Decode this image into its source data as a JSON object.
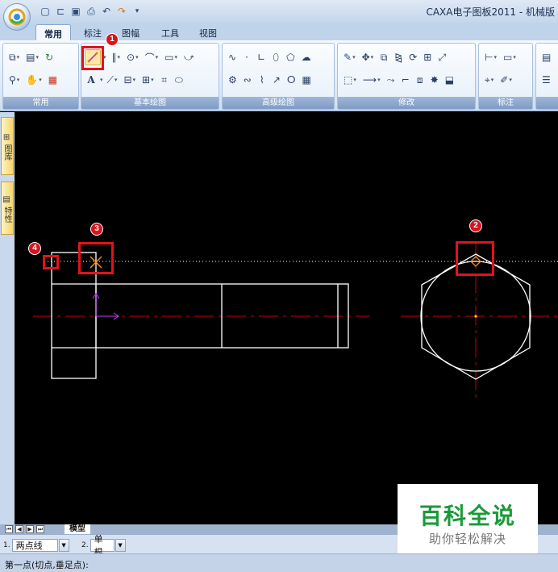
{
  "window": {
    "title": "CAXA电子图板2011 - 机械版"
  },
  "quick_access": [
    "new-icon",
    "open-icon",
    "save-icon",
    "print-icon",
    "undo-icon",
    "redo-icon",
    "customize-icon"
  ],
  "ribbon": {
    "tabs": [
      {
        "label": "常用",
        "active": true
      },
      {
        "label": "标注",
        "active": false
      },
      {
        "label": "图幅",
        "active": false
      },
      {
        "label": "工具",
        "active": false
      },
      {
        "label": "视图",
        "active": false
      }
    ],
    "groups": {
      "common": "常用",
      "basic_draw": "基本绘图",
      "advanced_draw": "高级绘图",
      "modify": "修改",
      "annotate": "标注"
    },
    "text_tool_glyph": "A"
  },
  "markers": {
    "m1": "1",
    "m2": "2",
    "m3": "3",
    "m4": "4"
  },
  "left_panel": {
    "tab1": "图库",
    "tab2": "特性"
  },
  "sheet_tabs": {
    "model": "模型"
  },
  "command_bar": {
    "item1_num": "1.",
    "item1_value": "两点线",
    "item2_num": "2.",
    "item2_value": "单根"
  },
  "status": {
    "prompt": "第一点(切点,垂足点):"
  },
  "watermark": {
    "title": "百科全说",
    "subtitle": "助你轻松解决"
  },
  "colors": {
    "canvas": "#000000",
    "geometry": "#ffffff",
    "centerline": "#cc0000",
    "highlight": "#e0131d",
    "snap": "#ff8c1a",
    "axis": "#c040ff",
    "watermark_green": "#1a9a3a"
  }
}
